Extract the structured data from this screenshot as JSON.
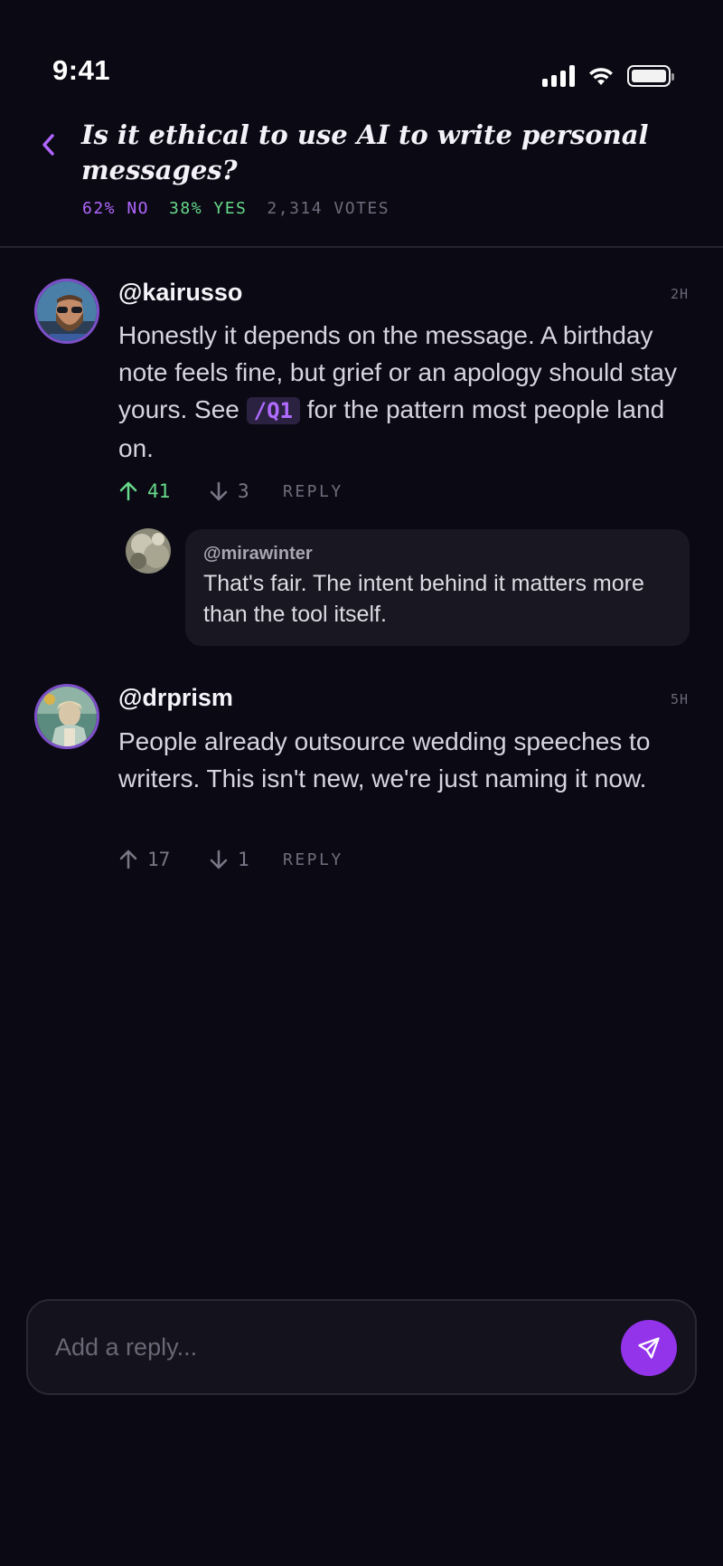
{
  "status_bar": {
    "time": "9:41"
  },
  "header": {
    "title": "Is it ethical to use AI to write personal messages?",
    "stat_no": "62% NO",
    "stat_yes": "38% YES",
    "stat_votes": "2,314 VOTES"
  },
  "comments": [
    {
      "username": "@kairusso",
      "timestamp": "2H",
      "text_before": "Honestly it depends on the message. A birthday note feels fine, but grief or an apology should stay yours. See ",
      "tag": "/Q1",
      "text_after": " for the pattern most people land on.",
      "upvotes": "41",
      "downvotes": "3",
      "reply_label": "REPLY",
      "replies": [
        {
          "username": "@mirawinter",
          "text": "That's fair. The intent behind it matters more than the tool itself."
        }
      ]
    },
    {
      "username": "@drprism",
      "timestamp": "5H",
      "text": "People already outsource wedding speeches to writers. This isn't new, we're just naming it now.",
      "upvotes": "17",
      "downvotes": "1",
      "reply_label": "REPLY"
    }
  ],
  "composer": {
    "placeholder": "Add a reply..."
  },
  "colors": {
    "background": "#0b0a14",
    "accent_purple": "#9333ea",
    "no_color": "#b066ff",
    "yes_color": "#67d98a"
  },
  "icons": {
    "back": "chevron-left-icon",
    "upvote": "arrow-up-icon",
    "downvote": "arrow-down-icon",
    "send": "send-icon"
  }
}
